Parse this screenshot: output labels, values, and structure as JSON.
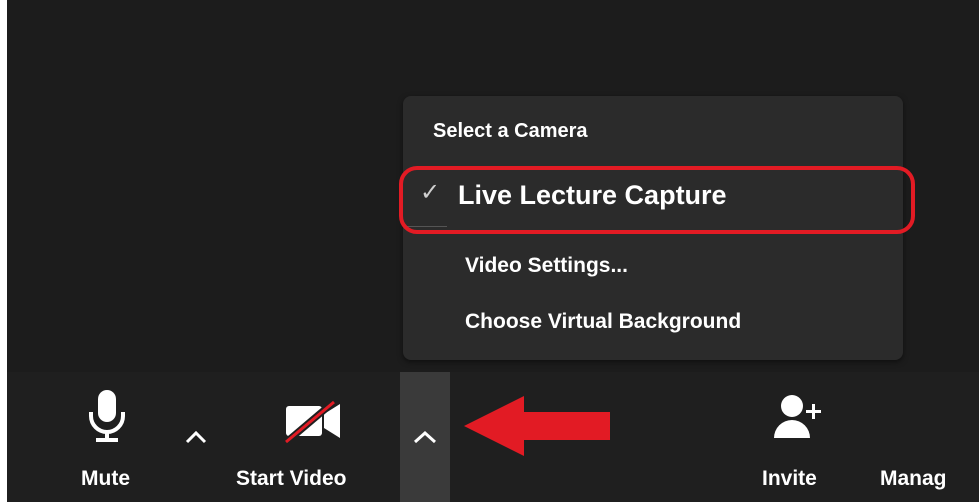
{
  "camera_menu": {
    "header": "Select a Camera",
    "selected_camera": "Live Lecture Capture",
    "check_glyph": "✓",
    "items": [
      "Video Settings...",
      "Choose Virtual Background"
    ]
  },
  "toolbar": {
    "mute_label": "Mute",
    "start_video_label": "Start Video",
    "invite_label": "Invite",
    "manage_label": "Manag"
  },
  "icons": {
    "microphone": "microphone-icon",
    "video_off": "video-off-icon",
    "add_user": "add-user-icon",
    "caret": "chevron-up-icon",
    "annotation_arrow": "red-arrow-annotation"
  },
  "colors": {
    "annotation_red": "#e21b24",
    "toolbar_bg": "#1f1f1f",
    "menu_bg": "#2b2b2b"
  }
}
